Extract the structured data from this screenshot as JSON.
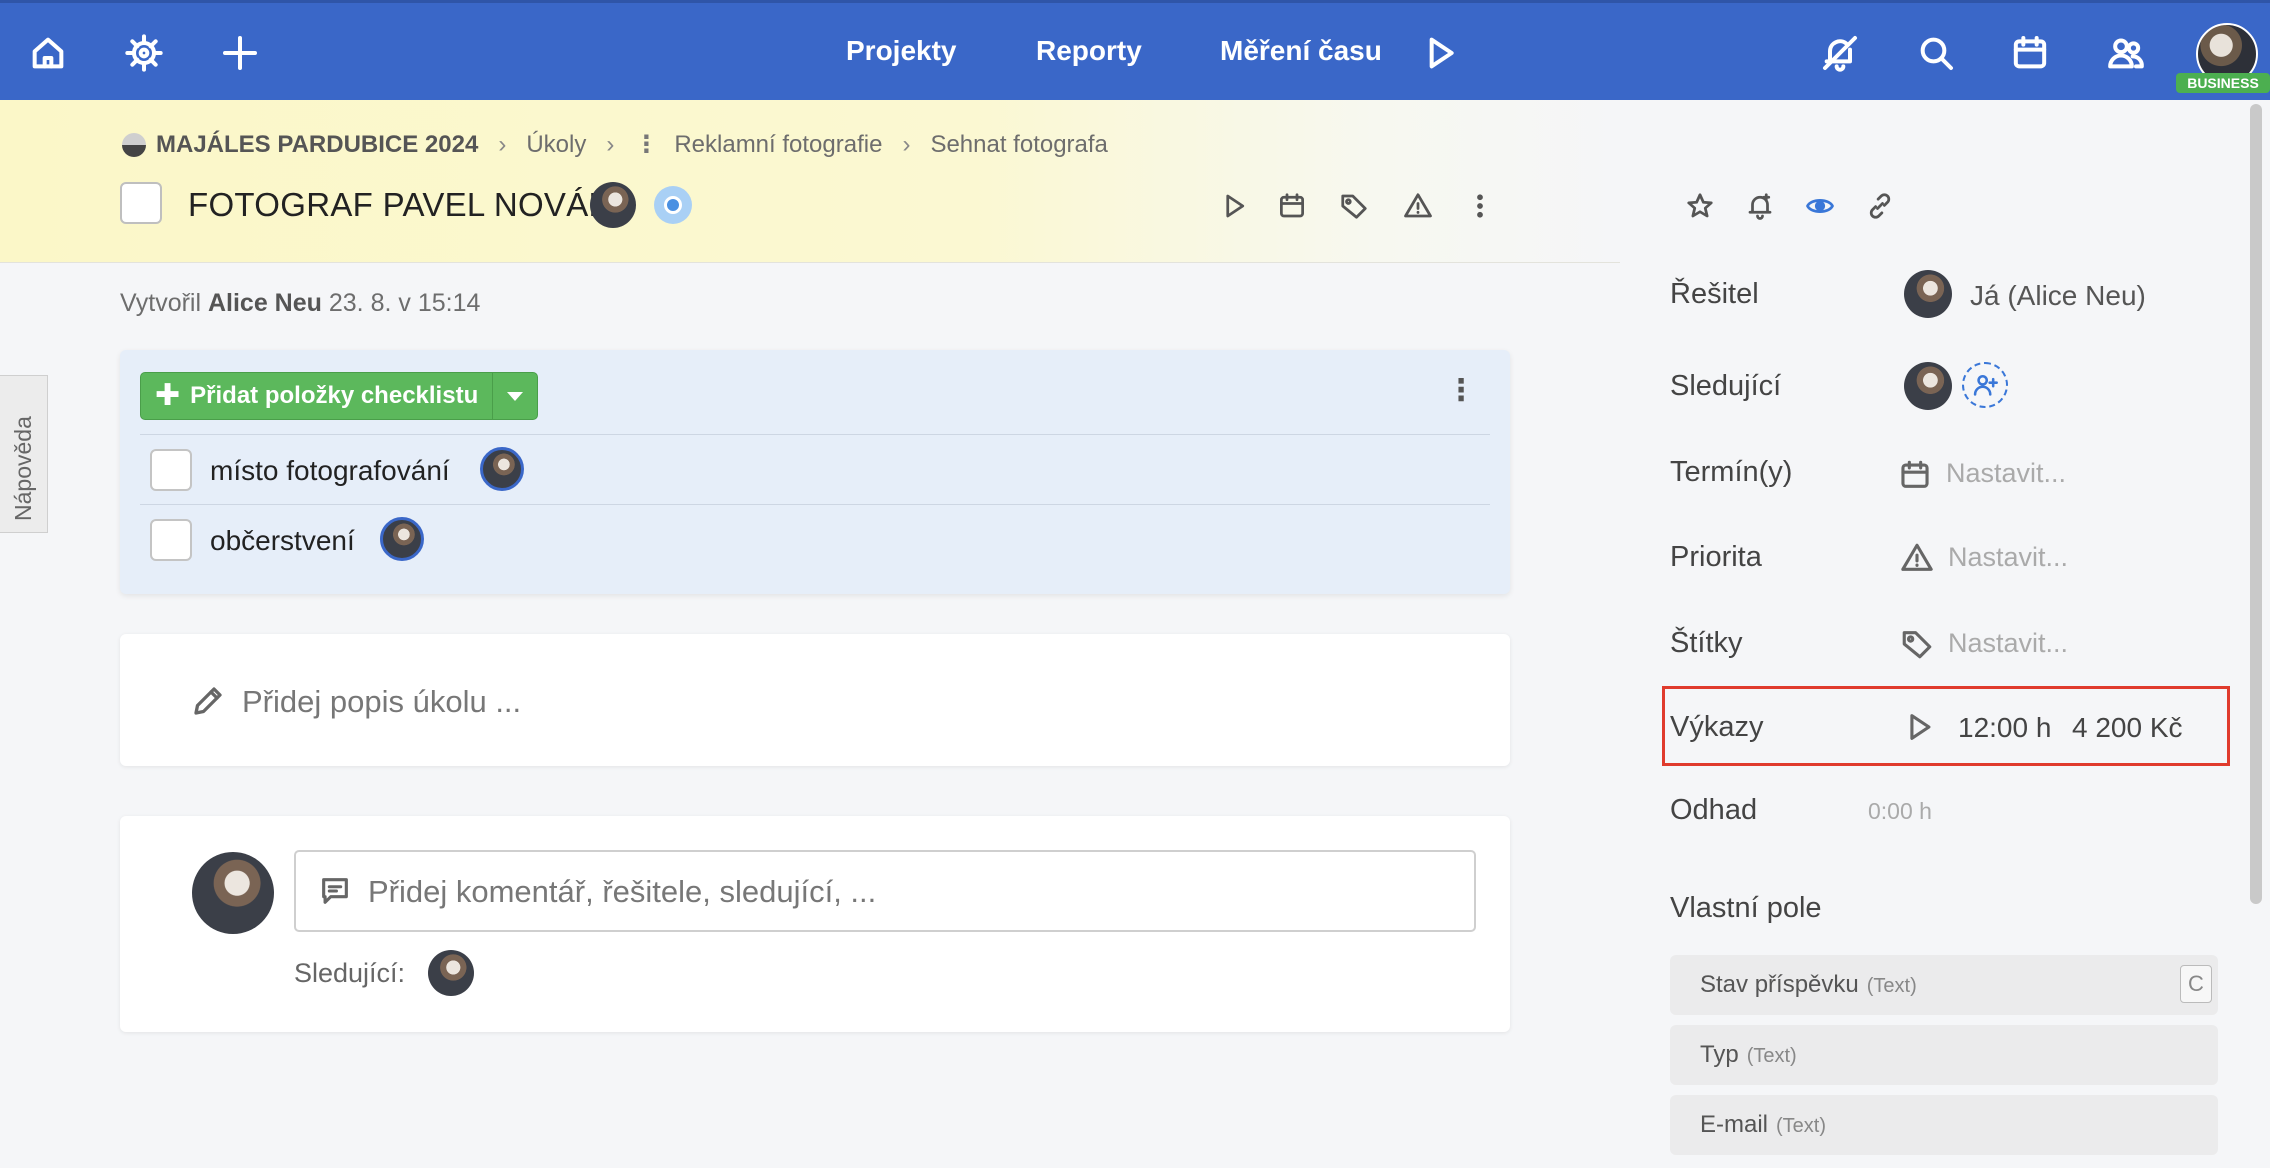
{
  "topbar": {
    "nav": [
      "Projekty",
      "Reporty",
      "Měření času"
    ],
    "icons_left": [
      "home-icon",
      "settings-wheel-icon",
      "plus-icon"
    ],
    "icons_right": [
      "notifications-off-icon",
      "search-icon",
      "calendar-icon",
      "users-icon"
    ],
    "badge": "BUSINESS"
  },
  "breadcrumb": {
    "project": "MAJÁLES PARDUBICE 2024",
    "items": [
      "Úkoly",
      "Reklamní fotografie",
      "Sehnat fotografa"
    ]
  },
  "task": {
    "title": "FOTOGRAF PAVEL NOVÁK",
    "meta_prefix": "Vytvořil",
    "meta_author": "Alice Neu",
    "meta_date": "23. 8. v 15:14"
  },
  "checklist": {
    "add_label": "Přidat položky checklistu",
    "items": [
      {
        "label": "místo fotografování"
      },
      {
        "label": "občerstvení"
      }
    ]
  },
  "description": {
    "placeholder": "Přidej popis úkolu ..."
  },
  "comment": {
    "placeholder": "Přidej komentář, řešitele, sledující, ...",
    "followers_label": "Sledující:"
  },
  "help_tab": "Nápověda",
  "sidebar": {
    "assignee_label": "Řešitel",
    "assignee_value": "Já (Alice Neu)",
    "followers_label": "Sledující",
    "dates_label": "Termín(y)",
    "dates_value": "Nastavit...",
    "priority_label": "Priorita",
    "priority_value": "Nastavit...",
    "tags_label": "Štítky",
    "tags_value": "Nastavit...",
    "reports_label": "Výkazy",
    "reports_hours": "12:00 h",
    "reports_amount": "4 200 Kč",
    "estimate_label": "Odhad",
    "estimate_value": "0:00 h",
    "custom_fields_label": "Vlastní pole",
    "custom_fields": [
      {
        "name": "Stav příspěvku",
        "type": "(Text)"
      },
      {
        "name": "Typ",
        "type": "(Text)"
      },
      {
        "name": "E-mail",
        "type": "(Text)"
      }
    ],
    "custom_field_badge": "C"
  },
  "colors": {
    "topbar": "#3a67c8",
    "accent_green": "#5cb85c",
    "highlight": "#e03b2d"
  }
}
